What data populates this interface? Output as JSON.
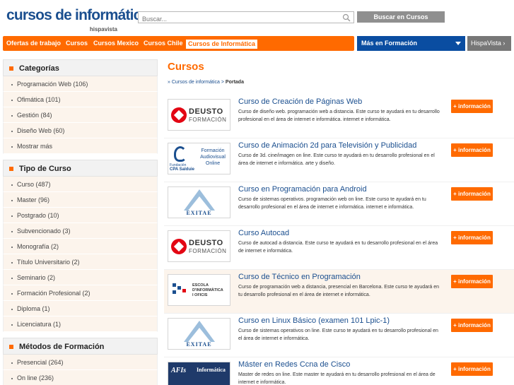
{
  "header": {
    "logo_text": "cursos de informática",
    "logo_sub": "hispavista",
    "search_placeholder": "Buscar...",
    "search_button": "Buscar en Cursos"
  },
  "nav": {
    "items": [
      "Ofertas de trabajo",
      "Cursos",
      "Cursos Mexico",
      "Cursos Chile",
      "Cursos de Informática"
    ],
    "active_index": 4,
    "more_label": "Más en Formación",
    "hispavista_label": "HispaVista ›"
  },
  "sidebar": {
    "sections": [
      {
        "title": "Categorías",
        "items": [
          "Programación Web (106)",
          "Ofimática (101)",
          "Gestión (84)",
          "Diseño Web (60)",
          "Mostrar más"
        ]
      },
      {
        "title": "Tipo de Curso",
        "items": [
          "Curso (487)",
          "Master (96)",
          "Postgrado (10)",
          "Subvencionado (3)",
          "Monografía (2)",
          "Título Universitario (2)",
          "Seminario (2)",
          "Formación Profesional (2)",
          "Diploma (1)",
          "Licenciatura (1)"
        ]
      },
      {
        "title": "Métodos de Formación",
        "items": [
          "Presencial (264)",
          "On line (236)"
        ]
      }
    ]
  },
  "main": {
    "title": "Cursos",
    "breadcrumb_link": "» Cursos de informática",
    "breadcrumb_sep": " > ",
    "breadcrumb_current": "Portada",
    "button_label": "+ información",
    "courses": [
      {
        "title": "Curso de Creación de Páginas Web",
        "desc": "Curso de diseño web. programación web a distancia. Este curso te ayudará en tu desarrollo profesional en el área de internet e informática. internet e informática.",
        "logo": "deusto",
        "logo_lines": [
          "DEUSTO",
          "FORMACIÓN"
        ]
      },
      {
        "title": "Curso de Animación 2d para Televisión y Publicidad",
        "desc": "Curso de 3d. cine/imagen on line. Este curso te ayudará en tu desarrollo profesional en el área de internet e informática. arte y diseño.",
        "logo": "cpa",
        "logo_lines": [
          "Fundación",
          "CPA Salduie",
          "Formación Audiovisual Online"
        ]
      },
      {
        "title": "Curso en Programación para Android",
        "desc": "Curso de sistemas operativos. programación web on line. Este curso te ayudará en tu desarrollo profesional en el área de internet e informática. internet e informática.",
        "logo": "exitae",
        "logo_lines": [
          "EXITAE"
        ]
      },
      {
        "title": "Curso Autocad",
        "desc": "Curso de autocad a distancia. Este curso te ayudará en tu desarrollo profesional en el área de internet e informática.",
        "logo": "deusto",
        "logo_lines": [
          "DEUSTO",
          "FORMACIÓN"
        ]
      },
      {
        "title": "Curso de Técnico en Programación",
        "desc": "Curso de programación web a distancia, presencial en Barcelona. Este curso te ayudará en tu desarrollo profesional en el área de internet e informática.",
        "logo": "escola",
        "logo_lines": [
          "ESCOLA",
          "D'INFORMÀTICA",
          "I OFICIS"
        ],
        "highlight": true
      },
      {
        "title": "Curso en Linux Básico (examen 101 Lpic-1)",
        "desc": "Curso de sistemas operativos on line. Este curso te ayudará en tu desarrollo profesional en el área de internet e informática.",
        "logo": "exitae",
        "logo_lines": [
          "EXITAE"
        ]
      },
      {
        "title": "Máster en Redes Ccna de Cisco",
        "desc": "Master de redes on line. Este master te ayudará en tu desarrollo profesional en el área de internet e informática.",
        "logo": "afi",
        "logo_lines": [
          "AFIs",
          "Informática"
        ]
      }
    ]
  },
  "colors": {
    "accent": "#ff6a00",
    "link": "#1b4f8f",
    "nav_blue": "#0a4da1",
    "sidebar_item_bg": "#fcf4ec"
  }
}
